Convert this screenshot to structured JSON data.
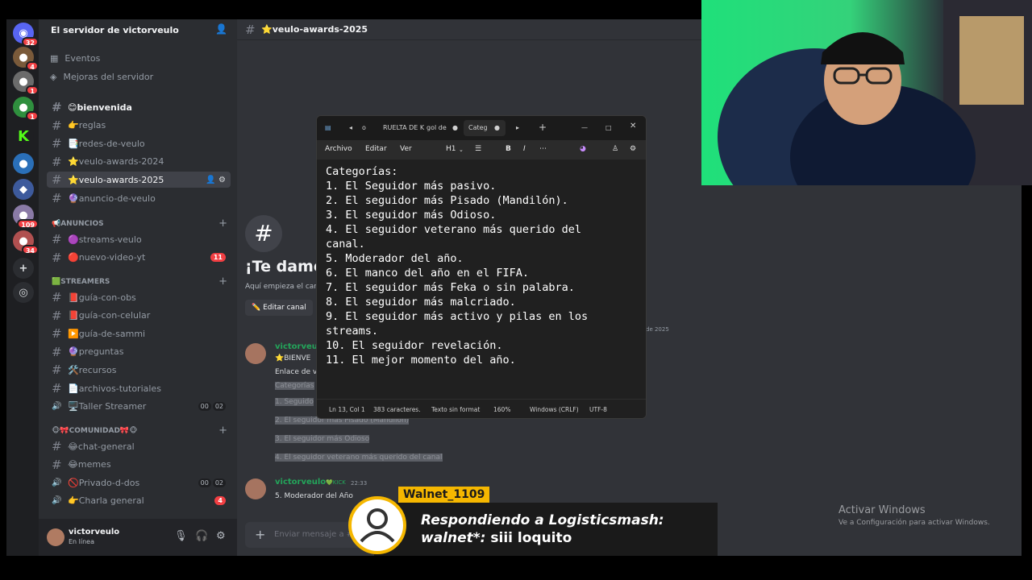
{
  "server": {
    "name": "El servidor de victorveulo",
    "badges": [
      "32",
      "4",
      "1",
      "1",
      "109",
      "34"
    ]
  },
  "nav": {
    "events": "Eventos",
    "boosts": "Mejoras del servidor"
  },
  "channels": [
    {
      "name": "😊bienvenida",
      "unread": true
    },
    {
      "name": "👉reglas"
    },
    {
      "name": "📑redes-de-veulo"
    },
    {
      "name": "⭐veulo-awards-2024"
    },
    {
      "name": "⭐veulo-awards-2025",
      "active": true
    },
    {
      "name": "🔮anuncio-de-veulo"
    }
  ],
  "categories": {
    "anuncios": "📢ANUNCIOS",
    "streamers": "🟩STREAMERS",
    "comunidad": "🐵🎀COMUNIDAD🎀🐵"
  },
  "anuncios_channels": [
    {
      "name": "🟣streams-veulo"
    },
    {
      "name": "🔴nuevo-video-yt",
      "count": "11"
    }
  ],
  "streamers_channels": [
    {
      "name": "📕guía-con-obs"
    },
    {
      "name": "📕guía-con-celular"
    },
    {
      "name": "▶️guía-de-sammi"
    },
    {
      "name": "🔮preguntas"
    },
    {
      "name": "🛠️recursos"
    },
    {
      "name": "📄archivos-tutoriales"
    },
    {
      "name": "🖥️Taller Streamer",
      "v1": "00",
      "v2": "02"
    }
  ],
  "comunidad_channels": [
    {
      "name": "😂chat-general"
    },
    {
      "name": "😂memes"
    },
    {
      "name": "🚫Privado-d-dos",
      "v1": "00",
      "v2": "02"
    },
    {
      "name": "👉Charla general",
      "count": "4"
    }
  ],
  "user": {
    "name": "victorveulo",
    "status": "En línea"
  },
  "header": {
    "channel": "⭐veulo-awards-2025"
  },
  "welcome": {
    "title": "¡Te damos",
    "sub": "Aquí empieza el car",
    "edit": "✏️ Editar canal",
    "date": "de 2025"
  },
  "messages": {
    "m1_name": "victorveulo",
    "m1_l1": "⭐BIENVE",
    "m1_l2": "Enlace de v",
    "m1_l3": "Categorías",
    "m1_l4": "1. Seguido",
    "m1_l5": "2. El seguidor más Pisado (Mandilón)",
    "m1_l6": "3. El seguidor más Odioso",
    "m1_l7": "4. El seguidor veterano más querido del canal",
    "m2_name": "victorveulo",
    "m2_tag": "💚KICK",
    "m2_time": "22:33",
    "m2_text": "5. Moderador del Año"
  },
  "compose": {
    "placeholder": "Enviar mensaje a #"
  },
  "notepad": {
    "tab1": "o",
    "tab2": "RUELTA DE K",
    "tab3": "gol de",
    "tab4": "Categ",
    "menu": [
      "Archivo",
      "Editar",
      "Ver"
    ],
    "heading": "H1",
    "text": "Categorías:\n1. El Seguidor más pasivo.\n2. El seguidor más Pisado (Mandilón).\n3. El seguidor más Odioso.\n4. El seguidor veterano más querido del\ncanal.\n5. Moderador del año.\n6. El manco del año en el FIFA.\n7. El seguidor más Feka o sin palabra.\n8. El seguidor más malcriado.\n9. El seguidor más activo y pilas en los\nstreams.\n10. El seguidor revelación.\n11. El mejor momento del año.",
    "status": [
      "Ln 13, Col 1",
      "383 caracteres.",
      "Texto sin format",
      "160%",
      "Windows (CRLF)",
      "UTF-8"
    ]
  },
  "activate": {
    "title": "Activar Windows",
    "sub": "Ve a Configuración para activar Windows."
  },
  "chat_overlay": {
    "username": "Walnet_1109",
    "line1": "Respondiendo a Logisticsmash:",
    "line2_user": "walnet*:",
    "line2_msg": "siii loquito"
  }
}
